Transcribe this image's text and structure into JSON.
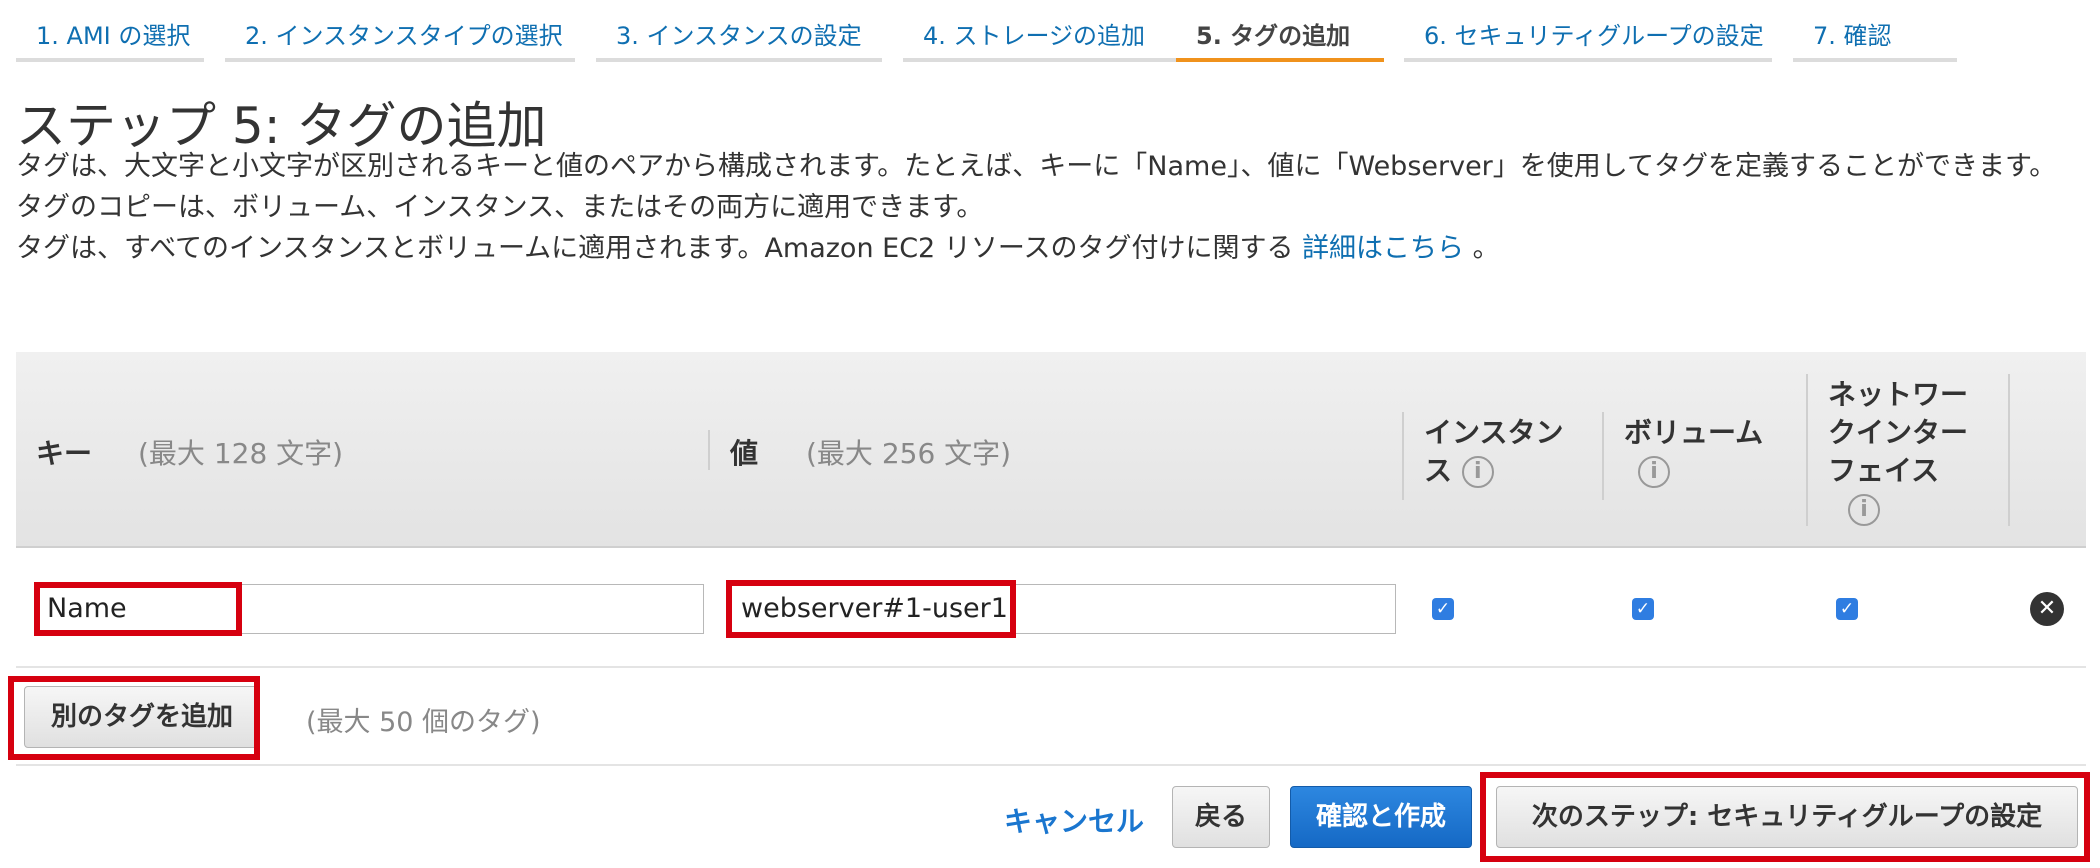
{
  "steps": [
    {
      "label": "1. AMI の選択"
    },
    {
      "label": "2. インスタンスタイプの選択"
    },
    {
      "label": "3. インスタンスの設定"
    },
    {
      "label": "4. ストレージの追加"
    },
    {
      "label": "5. タグの追加",
      "active": true
    },
    {
      "label": "6. セキュリティグループの設定"
    },
    {
      "label": "7. 確認"
    }
  ],
  "page": {
    "title": "ステップ 5: タグの追加",
    "desc_line1": "タグは、大文字と小文字が区別されるキーと値のペアから構成されます。たとえば、キーに「Name」、値に「Webserver」を使用してタグを定義することができます。",
    "desc_line2": "タグのコピーは、ボリューム、インスタンス、またはその両方に適用できます。",
    "desc_line3_prefix": "タグは、すべてのインスタンスとボリュームに適用されます。Amazon EC2 リソースのタグ付けに関する",
    "desc_link": "詳細はこちら",
    "desc_line3_suffix": "。"
  },
  "table": {
    "key_header": "キー",
    "key_note": "(最大 128 文字)",
    "value_header": "値",
    "value_note": "(最大 256 文字)",
    "instance_header_1": "インスタン",
    "instance_header_2": "ス",
    "volume_header": "ボリューム",
    "eni_header_1": "ネットワー",
    "eni_header_2": "クインター",
    "eni_header_3": "フェイス",
    "info_glyph": "i",
    "rows": [
      {
        "key": "Name",
        "value": "webserver#1-user1",
        "instance": true,
        "volume": true,
        "network_interface": true
      }
    ],
    "check_glyph": "✓",
    "remove_glyph": "✕"
  },
  "add": {
    "button_label": "別のタグを追加",
    "limit_note": "(最大 50 個のタグ)"
  },
  "footer": {
    "cancel": "キャンセル",
    "back": "戻る",
    "review_launch": "確認と作成",
    "next": "次のステップ: セキュリティグループの設定"
  },
  "colors": {
    "accent_orange": "#f0921c",
    "link_blue": "#0f6fb1",
    "primary_blue": "#1569c5",
    "highlight_red": "#d6000f",
    "checkbox_blue": "#2f7de1"
  },
  "icons": [
    "info-icon",
    "checkbox-checked-icon",
    "remove-circle-icon"
  ]
}
